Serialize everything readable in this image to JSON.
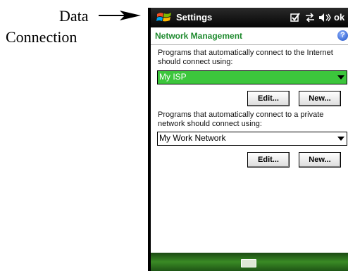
{
  "annotation": {
    "line1": "Data",
    "line2": "Connection"
  },
  "titlebar": {
    "title": "Settings",
    "ok_label": "ok",
    "icons": [
      "windows-start-icon",
      "checkbox-icon",
      "connectivity-icon",
      "speaker-icon"
    ]
  },
  "page": {
    "title": "Network Management",
    "help_icon": "?"
  },
  "internet": {
    "description": "Programs that automatically connect to the Internet should connect using:",
    "selected": "My ISP",
    "edit_label": "Edit...",
    "new_label": "New..."
  },
  "private": {
    "description": "Programs that automatically connect to a private network should connect using:",
    "selected": "My Work Network",
    "edit_label": "Edit...",
    "new_label": "New..."
  },
  "softbar": {
    "icon": "keyboard-icon"
  },
  "colors": {
    "title_green": "#1e8a2e",
    "selection_green": "#3cc63c",
    "softbar_green": "#3a8a25"
  }
}
